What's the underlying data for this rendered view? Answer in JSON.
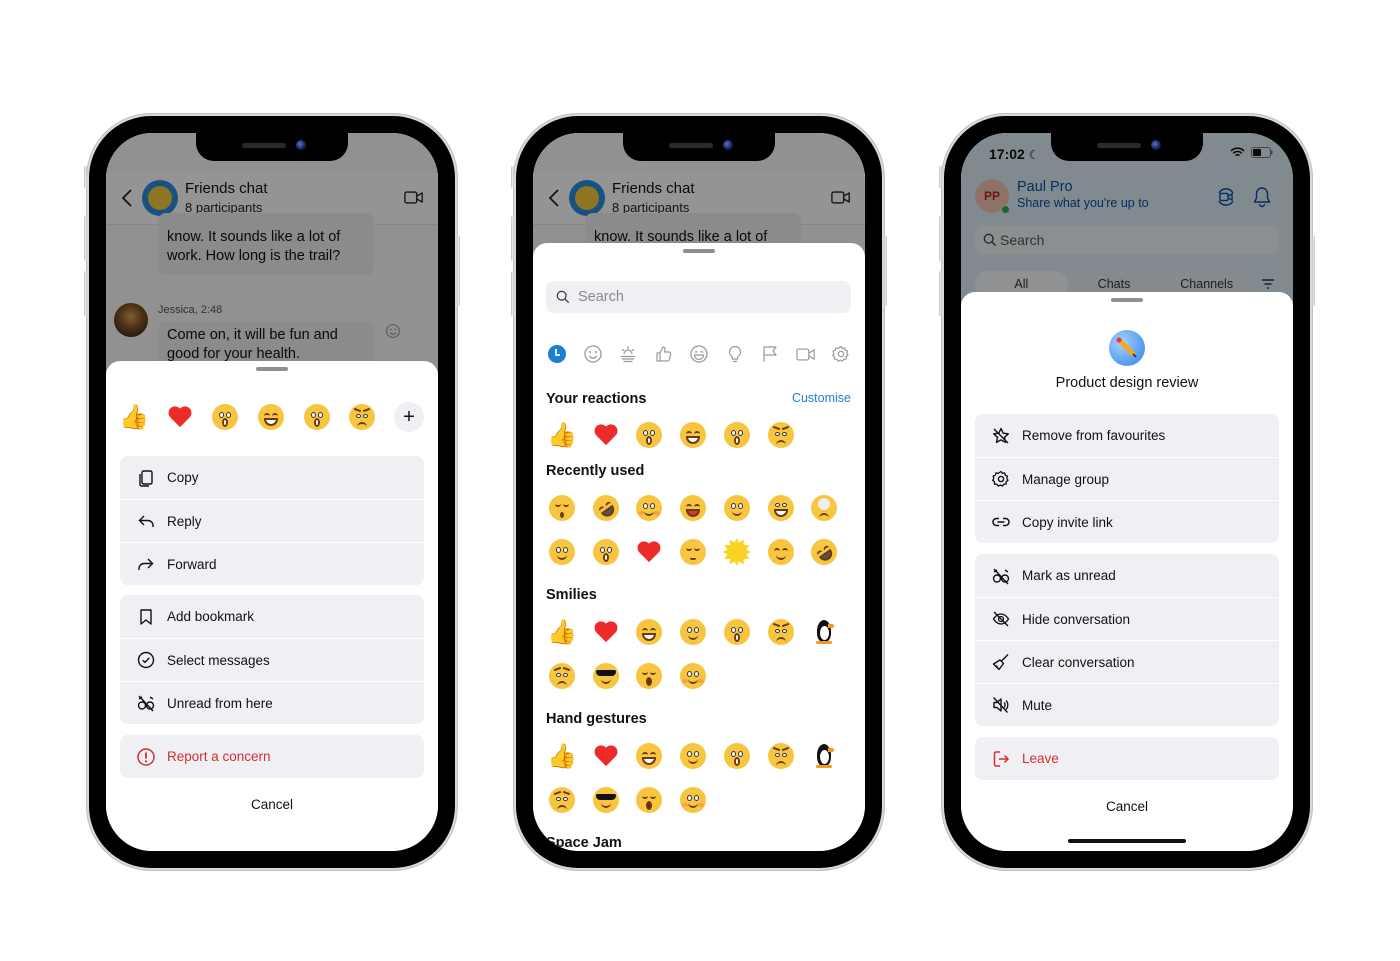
{
  "chat": {
    "title": "Friends chat",
    "subtitle": "8 participants",
    "message_1": "Hiking? Hmm, I don&apos;t know. It sounds like a lot of work. How long is the trail?",
    "message_1_visible_lines": [
      "know. It sounds like a lot of",
      "work. How long is the trail?"
    ],
    "message_2_meta": "Jessica, 2:48",
    "message_2": "Come on, it will be fun and good for your health."
  },
  "message_menu": {
    "reactions": [
      "thumbs-up",
      "heart",
      "surprised",
      "laughing",
      "surprised",
      "worried"
    ],
    "more_reactions_label": "+",
    "group_1": [
      {
        "label": "Copy",
        "icon": "copy-icon"
      },
      {
        "label": "Reply",
        "icon": "reply-icon"
      },
      {
        "label": "Forward",
        "icon": "forward-icon"
      }
    ],
    "group_2": [
      {
        "label": "Add bookmark",
        "icon": "bookmark-icon"
      },
      {
        "label": "Select messages",
        "icon": "check-circle-icon"
      },
      {
        "label": "Unread from here",
        "icon": "unread-icon"
      }
    ],
    "group_3": [
      {
        "label": "Report a concern",
        "icon": "alert-icon",
        "danger": true
      }
    ],
    "cancel_label": "Cancel"
  },
  "emoji_picker": {
    "search_placeholder": "Search",
    "category_tabs": [
      "recent",
      "smileys",
      "nature",
      "hand-gestures",
      "emoji",
      "objects",
      "flags",
      "video",
      "settings"
    ],
    "active_category": "recent",
    "your_reactions_title": "Your reactions",
    "customise_label": "Customise",
    "your_reactions": [
      "thumbs-up",
      "heart",
      "surprised",
      "laughing",
      "surprised",
      "worried"
    ],
    "recently_used_title": "Recently used",
    "recently_used": [
      "sleepy",
      "rofl",
      "blush",
      "tears-of-joy",
      "smile",
      "smirk",
      "facepalm",
      "thinking",
      "surprised",
      "heart",
      "unamused",
      "sun",
      "giggle",
      "rofl"
    ],
    "smilies_title": "Smilies",
    "smilies": [
      "thumbs-up",
      "heart",
      "laughing",
      "happy-tears",
      "surprised",
      "worried",
      "penguin",
      "angry",
      "cool",
      "yawn",
      "blush"
    ],
    "hand_gestures_title": "Hand gestures",
    "hand_gestures": [
      "thumbs-up",
      "heart",
      "laughing",
      "happy-tears",
      "surprised",
      "worried",
      "penguin",
      "angry",
      "cool",
      "yawn",
      "blush"
    ],
    "next_section_title": "Space Jam"
  },
  "chat_list": {
    "status_time": "17:02",
    "user_initials": "PP",
    "user_name": "Paul Pro",
    "user_status": "Share what you're up to",
    "search_placeholder": "Search",
    "filter_tabs": [
      "All",
      "Chats",
      "Channels"
    ],
    "active_filter": "All"
  },
  "conversation_menu": {
    "title": "Product design review",
    "group_1": [
      {
        "label": "Remove from favourites",
        "icon": "star-off-icon"
      },
      {
        "label": "Manage group",
        "icon": "gear-icon"
      },
      {
        "label": "Copy invite link",
        "icon": "link-icon"
      }
    ],
    "group_2": [
      {
        "label": "Mark as unread",
        "icon": "unread-icon"
      },
      {
        "label": "Hide conversation",
        "icon": "eye-off-icon"
      },
      {
        "label": "Clear conversation",
        "icon": "broom-icon"
      },
      {
        "label": "Mute",
        "icon": "mute-icon"
      }
    ],
    "group_3": [
      {
        "label": "Leave",
        "icon": "leave-icon",
        "danger": true
      }
    ],
    "cancel_label": "Cancel"
  },
  "colors": {
    "accent": "#1c7ed6",
    "danger": "#d32f2f",
    "sheet_row_bg": "#f0f0f4",
    "presence": "#2fb343"
  }
}
